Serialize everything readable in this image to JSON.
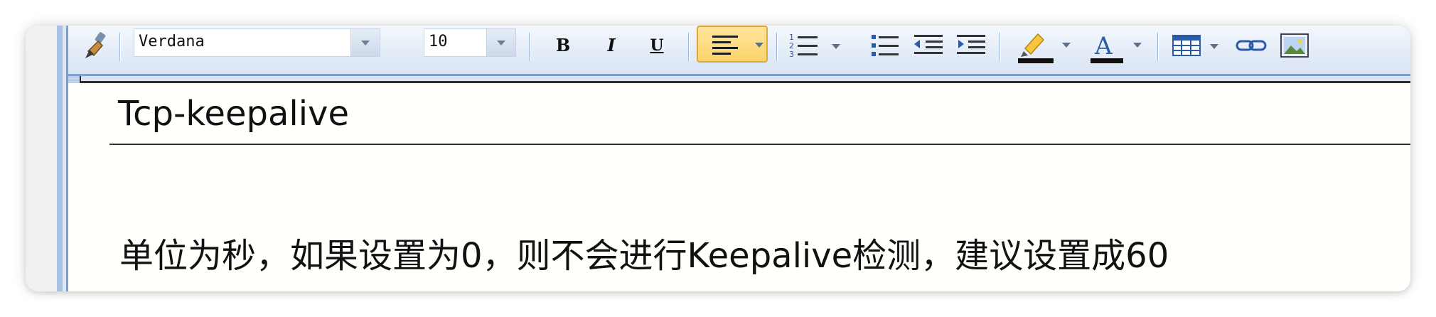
{
  "toolbar": {
    "font_family": "Verdana",
    "font_size": "10",
    "buttons": {
      "bold": "B",
      "italic": "I",
      "underline": "U",
      "font_color": "A"
    },
    "icons": {
      "format_painter": "brush-icon",
      "align": "align-left-icon",
      "numbered_list": "numbered-list-icon",
      "bulleted_list": "bulleted-list-icon",
      "outdent": "outdent-icon",
      "indent": "indent-icon",
      "highlight": "highlighter-icon",
      "font_color": "font-color-icon",
      "table": "table-icon",
      "link": "link-icon",
      "image": "image-icon"
    },
    "colors": {
      "highlight_bar": "#111111",
      "font_color_bar": "#111111",
      "active_button": "#fbd36c"
    }
  },
  "document": {
    "title": "Tcp-keepalive",
    "body": "单位为秒，如果设置为0，则不会进行Keepalive检测，建议设置成60"
  }
}
